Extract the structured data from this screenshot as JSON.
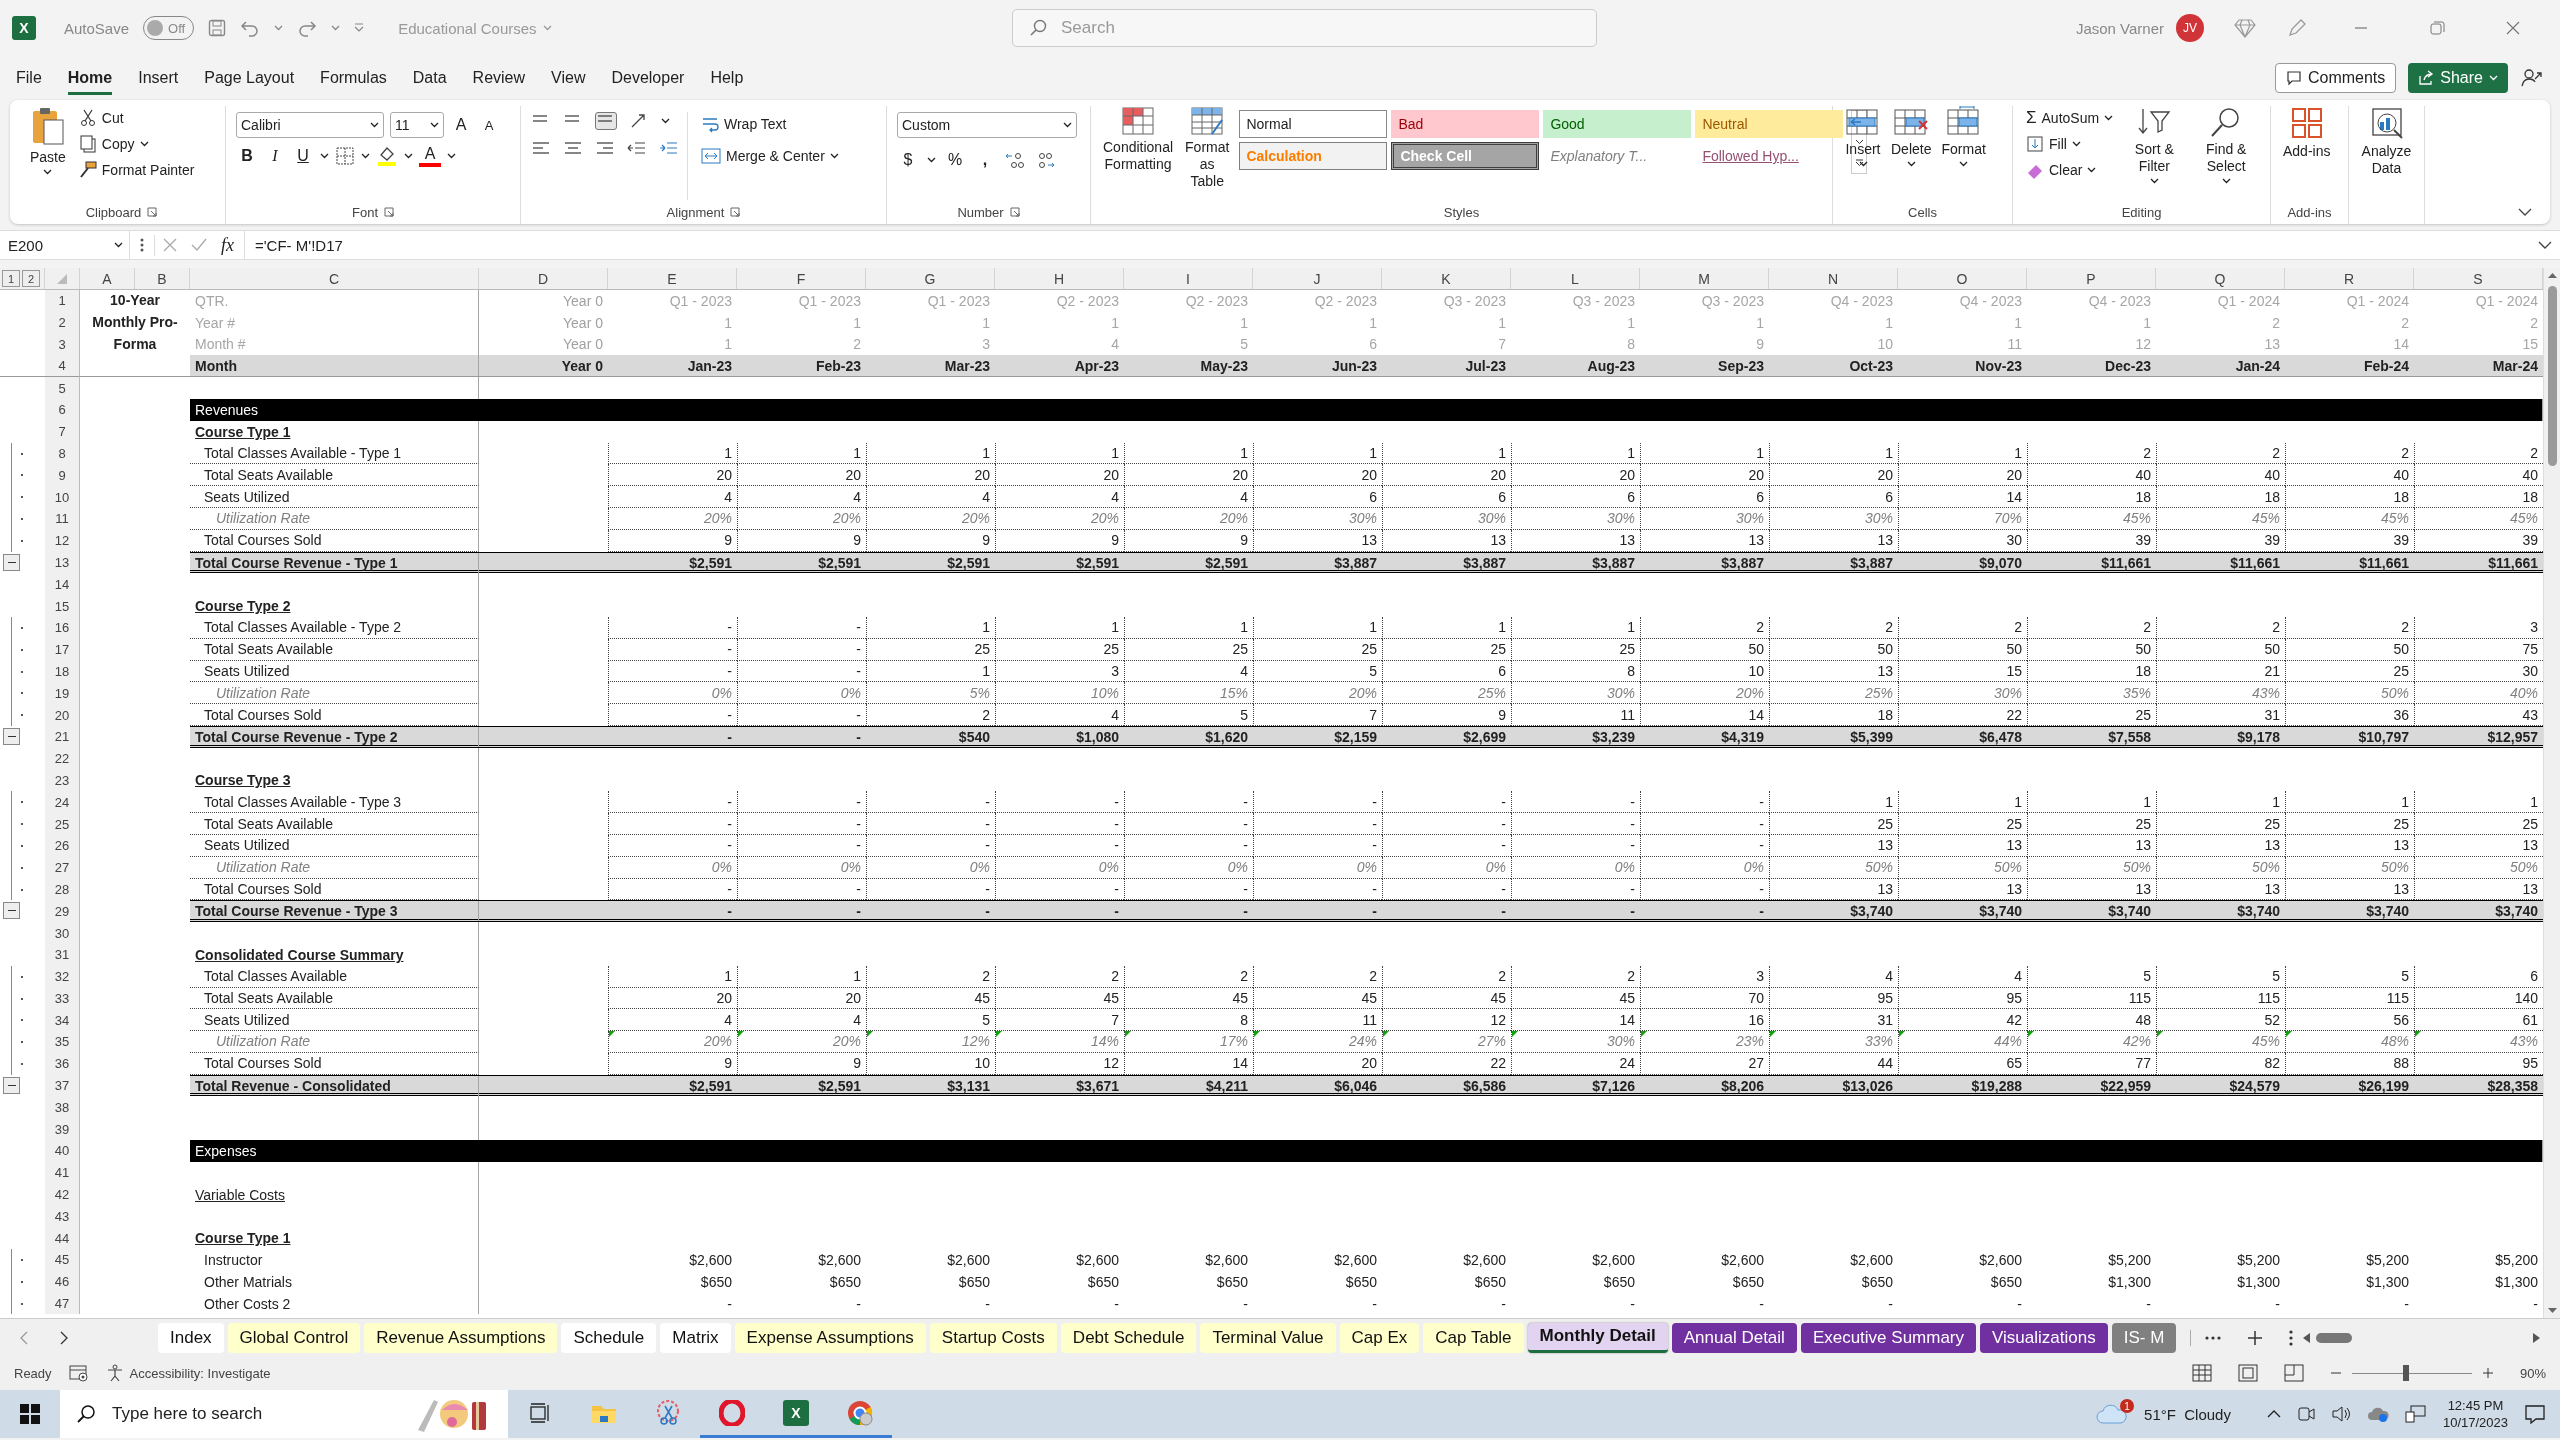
{
  "titlebar": {
    "logo": "X",
    "autosave_label": "AutoSave",
    "autosave_state": "Off",
    "autosave_on": false,
    "doc_title": "Educational Courses",
    "search_placeholder": "Search",
    "user_name": "Jason Varner",
    "user_initials": "JV"
  },
  "menu": [
    {
      "label": "File",
      "selected": false
    },
    {
      "label": "Home",
      "selected": true
    },
    {
      "label": "Insert",
      "selected": false
    },
    {
      "label": "Page Layout",
      "selected": false
    },
    {
      "label": "Formulas",
      "selected": false
    },
    {
      "label": "Data",
      "selected": false
    },
    {
      "label": "Review",
      "selected": false
    },
    {
      "label": "View",
      "selected": false
    },
    {
      "label": "Developer",
      "selected": false
    },
    {
      "label": "Help",
      "selected": false
    }
  ],
  "comments_button": "Comments",
  "share_button": "Share",
  "ribbon": {
    "clipboard": {
      "paste": "Paste",
      "cut": "Cut",
      "copy": "Copy",
      "format_painter": "Format Painter",
      "label": "Clipboard"
    },
    "font": {
      "name": "Calibri",
      "size": "11",
      "grow": "A",
      "shrink": "A",
      "bold": "B",
      "italic": "I",
      "underline": "U",
      "font_color": "A",
      "label": "Font"
    },
    "alignment": {
      "wrap": "Wrap Text",
      "merge": "Merge & Center",
      "label": "Alignment"
    },
    "number": {
      "format": "Custom",
      "currency": "$",
      "percent": "%",
      "comma": ",",
      "label": "Number"
    },
    "styles": {
      "conditional": "Conditional Formatting",
      "format_table": "Format as Table",
      "label": "Styles",
      "gallery": [
        {
          "text": "Normal",
          "kind": "normal"
        },
        {
          "text": "Bad",
          "kind": "bad"
        },
        {
          "text": "Good",
          "kind": "good"
        },
        {
          "text": "Neutral",
          "kind": "neutral"
        },
        {
          "text": "Calculation",
          "kind": "calculation"
        },
        {
          "text": "Check Cell",
          "kind": "check"
        },
        {
          "text": "Explanatory T...",
          "kind": "explanatory"
        },
        {
          "text": "Followed Hyp...",
          "kind": "hyperlink"
        }
      ]
    },
    "cells": {
      "buttons": [
        "Insert",
        "Delete",
        "Format"
      ],
      "label": "Cells"
    },
    "editing": {
      "autosum_symbol": "Σ",
      "autosum": "AutoSum",
      "fill": "Fill",
      "clear": "Clear",
      "sort": "Sort & Filter",
      "find": "Find & Select",
      "label": "Editing"
    },
    "addins": {
      "button": "Add-ins",
      "label": "Add-ins"
    },
    "analyze": {
      "button": "Analyze Data"
    }
  },
  "formula_bar": {
    "name_box": "E200",
    "fx": "fx",
    "formula": "='CF- M'!D17"
  },
  "outline_levels": [
    "1",
    "2"
  ],
  "columns": [
    "A",
    "B",
    "C",
    "D",
    "E",
    "F",
    "G",
    "H",
    "I",
    "J",
    "K",
    "L",
    "M",
    "N",
    "O",
    "P",
    "Q",
    "R",
    "S"
  ],
  "title_block": "10-Year Monthly Pro-Forma",
  "rows": [
    {
      "n": "1",
      "kind": "info",
      "label": "QTR.",
      "d": "Year 0",
      "values": [
        "Q1 - 2023",
        "Q1 - 2023",
        "Q1 - 2023",
        "Q2 - 2023",
        "Q2 - 2023",
        "Q2 - 2023",
        "Q3 - 2023",
        "Q3 - 2023",
        "Q3 - 2023",
        "Q4 - 2023",
        "Q4 - 2023",
        "Q4 - 2023",
        "Q1 - 2024",
        "Q1 - 2024",
        "Q1 - 2024"
      ]
    },
    {
      "n": "2",
      "kind": "info",
      "label": "Year #",
      "d": "Year 0",
      "values": [
        "1",
        "1",
        "1",
        "1",
        "1",
        "1",
        "1",
        "1",
        "1",
        "1",
        "1",
        "1",
        "2",
        "2",
        "2"
      ]
    },
    {
      "n": "3",
      "kind": "info",
      "label": "Month #",
      "d": "Year 0",
      "values": [
        "1",
        "2",
        "3",
        "4",
        "5",
        "6",
        "7",
        "8",
        "9",
        "10",
        "11",
        "12",
        "13",
        "14",
        "15"
      ]
    },
    {
      "n": "4",
      "kind": "month",
      "label": "Month",
      "d": "Year 0",
      "values": [
        "Jan-23",
        "Feb-23",
        "Mar-23",
        "Apr-23",
        "May-23",
        "Jun-23",
        "Jul-23",
        "Aug-23",
        "Sep-23",
        "Oct-23",
        "Nov-23",
        "Dec-23",
        "Jan-24",
        "Feb-24",
        "Mar-24"
      ]
    },
    {
      "n": "5",
      "kind": "blank"
    },
    {
      "n": "6",
      "kind": "band",
      "label": "Revenues"
    },
    {
      "n": "7",
      "kind": "section",
      "label": "Course Type 1"
    },
    {
      "n": "8",
      "kind": "item",
      "label": "Total Classes Available - Type 1",
      "values": [
        "1",
        "1",
        "1",
        "1",
        "1",
        "1",
        "1",
        "1",
        "1",
        "1",
        "1",
        "2",
        "2",
        "2",
        "2"
      ]
    },
    {
      "n": "9",
      "kind": "item",
      "label": "Total Seats Available",
      "values": [
        "20",
        "20",
        "20",
        "20",
        "20",
        "20",
        "20",
        "20",
        "20",
        "20",
        "20",
        "40",
        "40",
        "40",
        "40"
      ]
    },
    {
      "n": "10",
      "kind": "item",
      "label": "Seats Utilized",
      "values": [
        "4",
        "4",
        "4",
        "4",
        "4",
        "6",
        "6",
        "6",
        "6",
        "6",
        "14",
        "18",
        "18",
        "18",
        "18"
      ]
    },
    {
      "n": "11",
      "kind": "rate",
      "label": "Utilization Rate",
      "values": [
        "20%",
        "20%",
        "20%",
        "20%",
        "20%",
        "30%",
        "30%",
        "30%",
        "30%",
        "30%",
        "70%",
        "45%",
        "45%",
        "45%",
        "45%"
      ]
    },
    {
      "n": "12",
      "kind": "item",
      "label": "Total Courses Sold",
      "values": [
        "9",
        "9",
        "9",
        "9",
        "9",
        "13",
        "13",
        "13",
        "13",
        "13",
        "30",
        "39",
        "39",
        "39",
        "39"
      ]
    },
    {
      "n": "13",
      "kind": "total",
      "label": "Total Course Revenue - Type 1",
      "values": [
        "$2,591",
        "$2,591",
        "$2,591",
        "$2,591",
        "$2,591",
        "$3,887",
        "$3,887",
        "$3,887",
        "$3,887",
        "$3,887",
        "$9,070",
        "$11,661",
        "$11,661",
        "$11,661",
        "$11,661"
      ]
    },
    {
      "n": "14",
      "kind": "blank"
    },
    {
      "n": "15",
      "kind": "section",
      "label": "Course Type 2"
    },
    {
      "n": "16",
      "kind": "item",
      "label": "Total Classes Available - Type 2",
      "values": [
        "-",
        "-",
        "1",
        "1",
        "1",
        "1",
        "1",
        "1",
        "2",
        "2",
        "2",
        "2",
        "2",
        "2",
        "3"
      ]
    },
    {
      "n": "17",
      "kind": "item",
      "label": "Total Seats Available",
      "values": [
        "-",
        "-",
        "25",
        "25",
        "25",
        "25",
        "25",
        "25",
        "50",
        "50",
        "50",
        "50",
        "50",
        "50",
        "75"
      ]
    },
    {
      "n": "18",
      "kind": "item",
      "label": "Seats Utilized",
      "values": [
        "-",
        "-",
        "1",
        "3",
        "4",
        "5",
        "6",
        "8",
        "10",
        "13",
        "15",
        "18",
        "21",
        "25",
        "30"
      ]
    },
    {
      "n": "19",
      "kind": "rate",
      "label": "Utilization Rate",
      "values": [
        "0%",
        "0%",
        "5%",
        "10%",
        "15%",
        "20%",
        "25%",
        "30%",
        "20%",
        "25%",
        "30%",
        "35%",
        "43%",
        "50%",
        "40%"
      ]
    },
    {
      "n": "20",
      "kind": "item",
      "label": "Total Courses Sold",
      "values": [
        "-",
        "-",
        "2",
        "4",
        "5",
        "7",
        "9",
        "11",
        "14",
        "18",
        "22",
        "25",
        "31",
        "36",
        "43"
      ]
    },
    {
      "n": "21",
      "kind": "total",
      "label": "Total Course Revenue - Type 2",
      "values": [
        "-",
        "-",
        "$540",
        "$1,080",
        "$1,620",
        "$2,159",
        "$2,699",
        "$3,239",
        "$4,319",
        "$5,399",
        "$6,478",
        "$7,558",
        "$9,178",
        "$10,797",
        "$12,957"
      ]
    },
    {
      "n": "22",
      "kind": "blank"
    },
    {
      "n": "23",
      "kind": "section",
      "label": "Course Type 3"
    },
    {
      "n": "24",
      "kind": "item",
      "label": "Total Classes Available - Type 3",
      "values": [
        "-",
        "-",
        "-",
        "-",
        "-",
        "-",
        "-",
        "-",
        "-",
        "1",
        "1",
        "1",
        "1",
        "1",
        "1"
      ]
    },
    {
      "n": "25",
      "kind": "item",
      "label": "Total Seats Available",
      "values": [
        "-",
        "-",
        "-",
        "-",
        "-",
        "-",
        "-",
        "-",
        "-",
        "25",
        "25",
        "25",
        "25",
        "25",
        "25"
      ]
    },
    {
      "n": "26",
      "kind": "item",
      "label": "Seats Utilized",
      "values": [
        "-",
        "-",
        "-",
        "-",
        "-",
        "-",
        "-",
        "-",
        "-",
        "13",
        "13",
        "13",
        "13",
        "13",
        "13"
      ]
    },
    {
      "n": "27",
      "kind": "rate",
      "label": "Utilization Rate",
      "values": [
        "0%",
        "0%",
        "0%",
        "0%",
        "0%",
        "0%",
        "0%",
        "0%",
        "0%",
        "50%",
        "50%",
        "50%",
        "50%",
        "50%",
        "50%"
      ]
    },
    {
      "n": "28",
      "kind": "item",
      "label": "Total Courses Sold",
      "values": [
        "-",
        "-",
        "-",
        "-",
        "-",
        "-",
        "-",
        "-",
        "-",
        "13",
        "13",
        "13",
        "13",
        "13",
        "13"
      ]
    },
    {
      "n": "29",
      "kind": "total",
      "label": "Total Course Revenue - Type 3",
      "values": [
        "-",
        "-",
        "-",
        "-",
        "-",
        "-",
        "-",
        "-",
        "-",
        "$3,740",
        "$3,740",
        "$3,740",
        "$3,740",
        "$3,740",
        "$3,740"
      ]
    },
    {
      "n": "30",
      "kind": "blank"
    },
    {
      "n": "31",
      "kind": "section",
      "label": "Consolidated Course Summary"
    },
    {
      "n": "32",
      "kind": "item",
      "label": "Total Classes Available",
      "values": [
        "1",
        "1",
        "2",
        "2",
        "2",
        "2",
        "2",
        "2",
        "3",
        "4",
        "4",
        "5",
        "5",
        "5",
        "6"
      ]
    },
    {
      "n": "33",
      "kind": "item",
      "label": "Total Seats Available",
      "values": [
        "20",
        "20",
        "45",
        "45",
        "45",
        "45",
        "45",
        "45",
        "70",
        "95",
        "95",
        "115",
        "115",
        "115",
        "140"
      ]
    },
    {
      "n": "34",
      "kind": "item",
      "label": "Seats Utilized",
      "values": [
        "4",
        "4",
        "5",
        "7",
        "8",
        "11",
        "12",
        "14",
        "16",
        "31",
        "42",
        "48",
        "52",
        "56",
        "61"
      ]
    },
    {
      "n": "35",
      "kind": "rate",
      "label": "Utilization Rate",
      "flagged": true,
      "values": [
        "20%",
        "20%",
        "12%",
        "14%",
        "17%",
        "24%",
        "27%",
        "30%",
        "23%",
        "33%",
        "44%",
        "42%",
        "45%",
        "48%",
        "43%"
      ]
    },
    {
      "n": "36",
      "kind": "item",
      "label": "Total Courses Sold",
      "values": [
        "9",
        "9",
        "10",
        "12",
        "14",
        "20",
        "22",
        "24",
        "27",
        "44",
        "65",
        "77",
        "82",
        "88",
        "95"
      ]
    },
    {
      "n": "37",
      "kind": "total",
      "label": "Total Revenue - Consolidated",
      "values": [
        "$2,591",
        "$2,591",
        "$3,131",
        "$3,671",
        "$4,211",
        "$6,046",
        "$6,586",
        "$7,126",
        "$8,206",
        "$13,026",
        "$19,288",
        "$22,959",
        "$24,579",
        "$26,199",
        "$28,358"
      ]
    },
    {
      "n": "38",
      "kind": "blank"
    },
    {
      "n": "39",
      "kind": "blank"
    },
    {
      "n": "40",
      "kind": "band",
      "label": "Expenses"
    },
    {
      "n": "41",
      "kind": "blank"
    },
    {
      "n": "42",
      "kind": "link",
      "label": "Variable Costs"
    },
    {
      "n": "43",
      "kind": "blank"
    },
    {
      "n": "44",
      "kind": "section",
      "label": "Course Type 1"
    },
    {
      "n": "45",
      "kind": "cost",
      "label": "Instructor",
      "values": [
        "$2,600",
        "$2,600",
        "$2,600",
        "$2,600",
        "$2,600",
        "$2,600",
        "$2,600",
        "$2,600",
        "$2,600",
        "$2,600",
        "$2,600",
        "$5,200",
        "$5,200",
        "$5,200",
        "$5,200"
      ]
    },
    {
      "n": "46",
      "kind": "cost",
      "label": "Other Matrials",
      "values": [
        "$650",
        "$650",
        "$650",
        "$650",
        "$650",
        "$650",
        "$650",
        "$650",
        "$650",
        "$650",
        "$650",
        "$1,300",
        "$1,300",
        "$1,300",
        "$1,300"
      ]
    },
    {
      "n": "47",
      "kind": "cost",
      "label": "Other Costs 2",
      "values": [
        "-",
        "-",
        "-",
        "-",
        "-",
        "-",
        "-",
        "-",
        "-",
        "-",
        "-",
        "-",
        "-",
        "-",
        "-"
      ]
    }
  ],
  "sheet_tabs": [
    {
      "label": "Index",
      "color": "#ffffff",
      "selected": false
    },
    {
      "label": "Global Control",
      "color": "#ffffcc",
      "selected": false
    },
    {
      "label": "Revenue Assumptions",
      "color": "#ffffcc",
      "selected": false
    },
    {
      "label": "Schedule",
      "color": "#ffffff",
      "selected": false
    },
    {
      "label": "Matrix",
      "color": "#ffffff",
      "selected": false
    },
    {
      "label": "Expense Assumptions",
      "color": "#ffffcc",
      "selected": false
    },
    {
      "label": "Startup Costs",
      "color": "#ffffcc",
      "selected": false
    },
    {
      "label": "Debt Schedule",
      "color": "#ffffcc",
      "selected": false
    },
    {
      "label": "Terminal Value",
      "color": "#ffffcc",
      "selected": false
    },
    {
      "label": "Cap Ex",
      "color": "#ffffcc",
      "selected": false
    },
    {
      "label": "Cap Table",
      "color": "#ffffcc",
      "selected": false
    },
    {
      "label": "Monthly Detail",
      "color": "#e2d4f0",
      "selected": true
    },
    {
      "label": "Annual Detail",
      "color": "#7030a0",
      "selected": false
    },
    {
      "label": "Executive Summary",
      "color": "#7030a0",
      "selected": false
    },
    {
      "label": "Visualizations",
      "color": "#7030a0",
      "selected": false
    },
    {
      "label": "IS- M",
      "color": "#808080",
      "selected": false
    }
  ],
  "status": {
    "ready": "Ready",
    "accessibility": "Accessibility: Investigate",
    "zoom_slider": {
      "level": 0.45
    },
    "zoom": "90%"
  },
  "taskbar": {
    "search_placeholder": "Type here to search",
    "excel_logo": "X",
    "weather_badge": "1",
    "weather": "51°F  Cloudy",
    "time": "12:45 PM",
    "date": "10/17/2023"
  }
}
